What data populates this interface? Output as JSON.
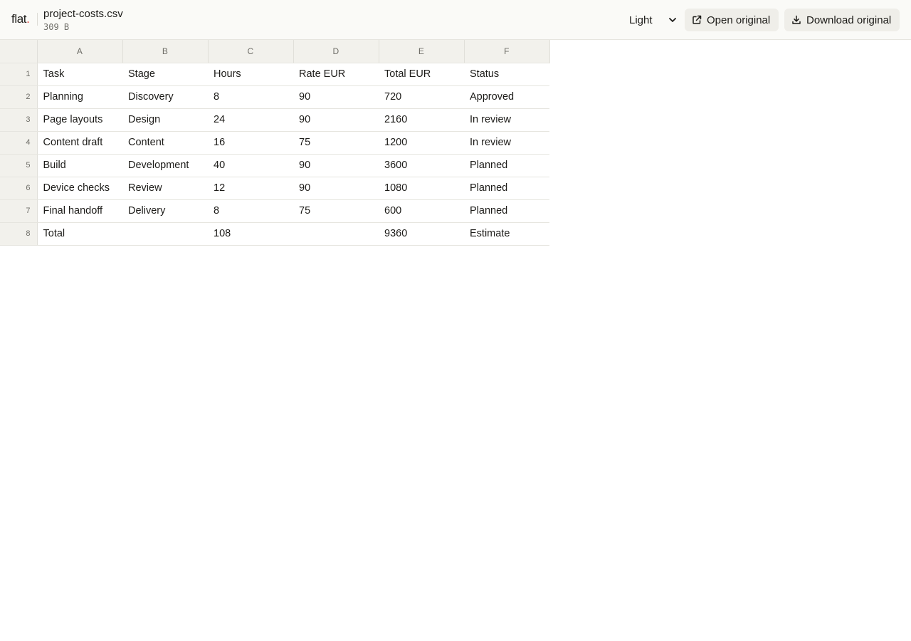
{
  "header": {
    "logo": "flat",
    "logo_dot": ".",
    "file_name": "project-costs.csv",
    "file_size": "309 B",
    "theme": "Light",
    "open_label": "Open original",
    "download_label": "Download original"
  },
  "icons": {
    "theme_chevron": "chevron-down-icon",
    "open": "external-link-icon",
    "download": "download-icon"
  },
  "colors": {
    "accent_dot": "#e0443a",
    "topbar_bg": "#fafaf7",
    "header_bg": "#f2f1ec",
    "button_bg": "#efeee9"
  },
  "sheet": {
    "columns": [
      "A",
      "B",
      "C",
      "D",
      "E",
      "F"
    ],
    "rows": [
      {
        "num": "1",
        "cells": [
          "Task",
          "Stage",
          "Hours",
          "Rate EUR",
          "Total EUR",
          "Status"
        ]
      },
      {
        "num": "2",
        "cells": [
          "Planning",
          "Discovery",
          "8",
          "90",
          "720",
          "Approved"
        ]
      },
      {
        "num": "3",
        "cells": [
          "Page layouts",
          "Design",
          "24",
          "90",
          "2160",
          "In review"
        ]
      },
      {
        "num": "4",
        "cells": [
          "Content draft",
          "Content",
          "16",
          "75",
          "1200",
          "In review"
        ]
      },
      {
        "num": "5",
        "cells": [
          "Build",
          "Development",
          "40",
          "90",
          "3600",
          "Planned"
        ]
      },
      {
        "num": "6",
        "cells": [
          "Device checks",
          "Review",
          "12",
          "90",
          "1080",
          "Planned"
        ]
      },
      {
        "num": "7",
        "cells": [
          "Final handoff",
          "Delivery",
          "8",
          "75",
          "600",
          "Planned"
        ]
      },
      {
        "num": "8",
        "cells": [
          "Total",
          "",
          "108",
          "",
          "9360",
          "Estimate"
        ]
      }
    ]
  }
}
